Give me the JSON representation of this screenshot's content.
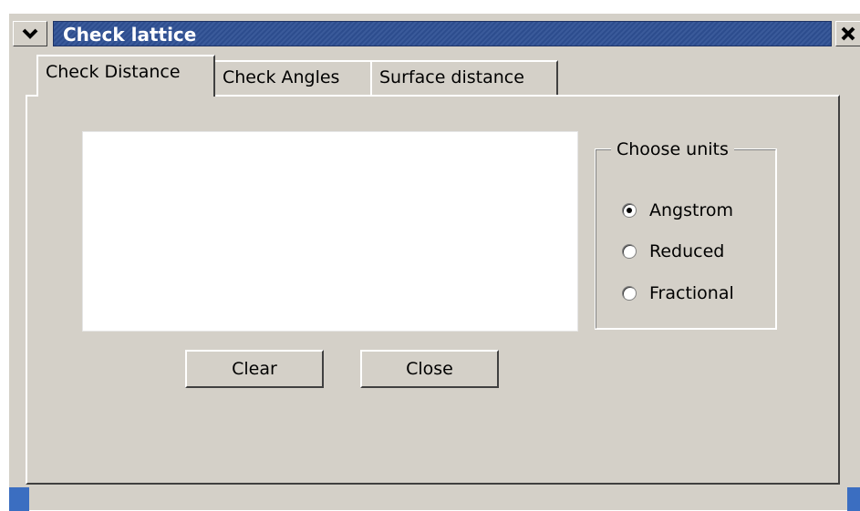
{
  "window": {
    "title": "Check lattice"
  },
  "tabs": [
    {
      "label": "Check Distance",
      "active": true
    },
    {
      "label": "Check Angles",
      "active": false
    },
    {
      "label": "Surface distance",
      "active": false
    }
  ],
  "output": {
    "text": ""
  },
  "units": {
    "legend": "Choose units",
    "options": [
      {
        "label": "Angstrom",
        "checked": true
      },
      {
        "label": "Reduced",
        "checked": false
      },
      {
        "label": "Fractional",
        "checked": false
      }
    ]
  },
  "buttons": {
    "clear_label": "Clear",
    "close_label": "Close"
  },
  "colors": {
    "title_bar": "#2d4d8e",
    "dialog_bg": "#d4d0c8"
  }
}
